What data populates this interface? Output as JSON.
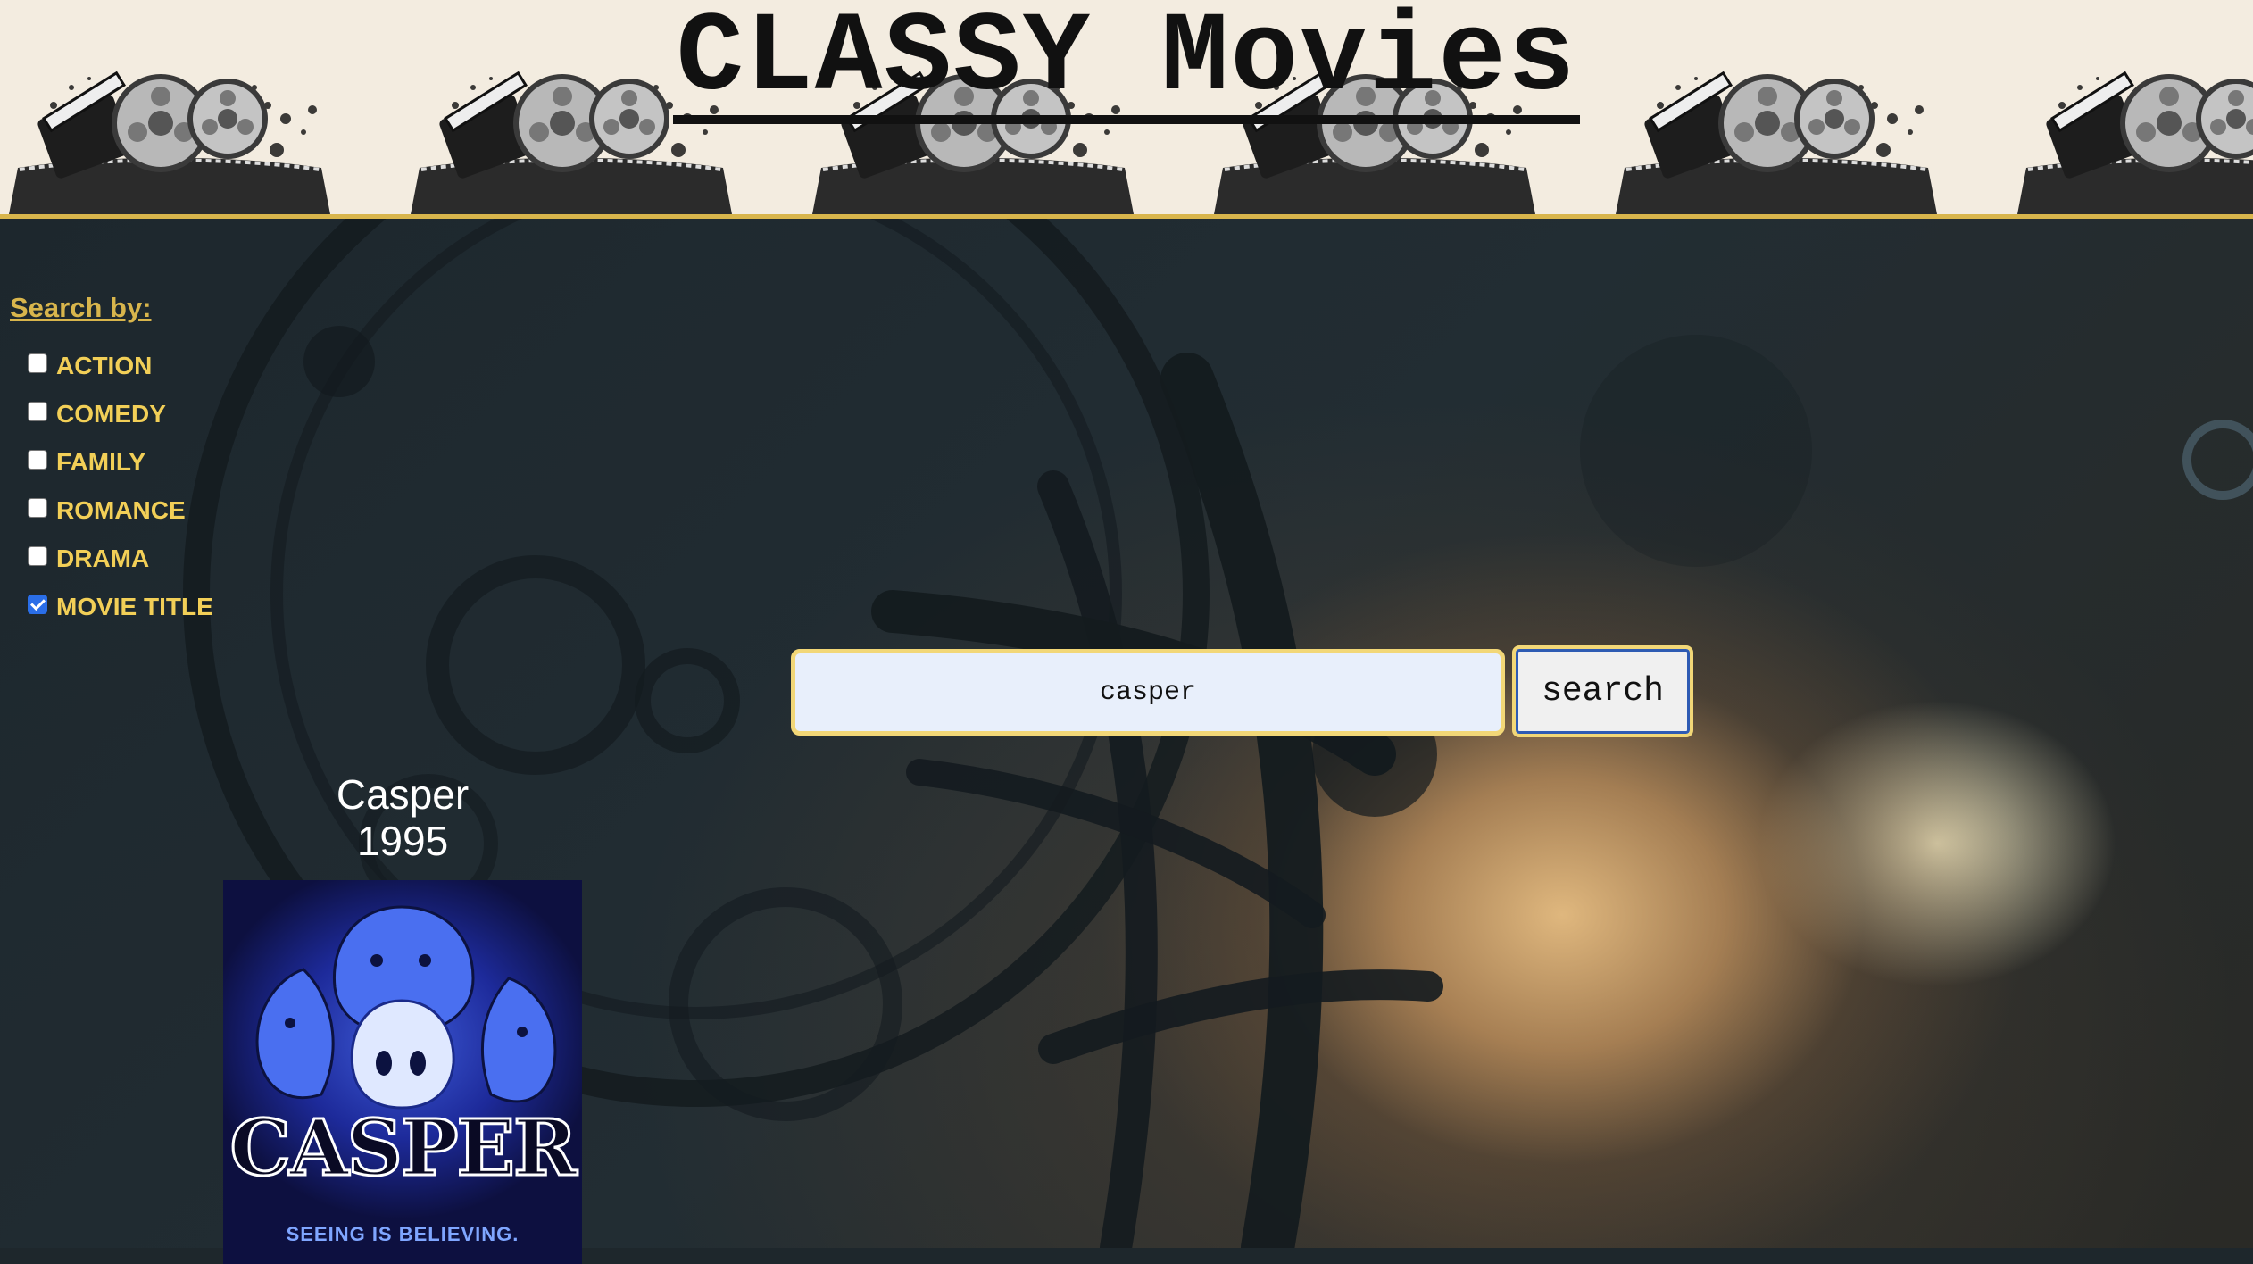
{
  "header": {
    "title": "CLASSY Movies"
  },
  "sidebar": {
    "heading": "Search by:",
    "filters": [
      {
        "label": "ACTION",
        "checked": false
      },
      {
        "label": "COMEDY",
        "checked": false
      },
      {
        "label": "FAMILY",
        "checked": false
      },
      {
        "label": "ROMANCE",
        "checked": false
      },
      {
        "label": "DRAMA",
        "checked": false
      },
      {
        "label": "MOVIE TITLE",
        "checked": true
      }
    ]
  },
  "search": {
    "value": "casper",
    "button_label": "search"
  },
  "result": {
    "title": "Casper",
    "year": "1995",
    "poster": {
      "logo_text": "CASPER",
      "tagline": "SEEING IS BELIEVING."
    }
  },
  "colors": {
    "accent_gold": "#f2cf57",
    "header_bg": "#f3ece0",
    "checkbox_blue": "#2a6ee8"
  }
}
